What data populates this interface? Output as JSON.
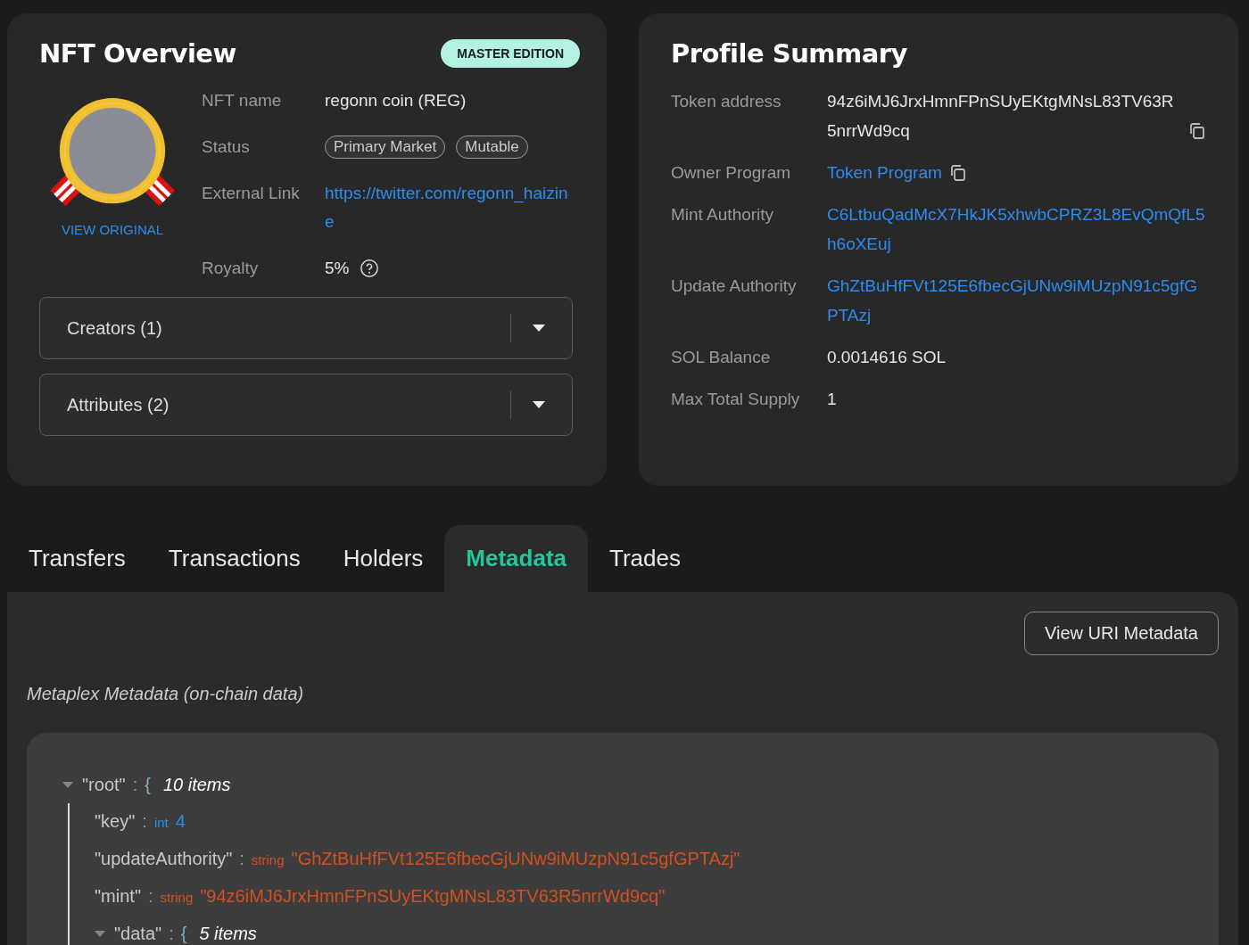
{
  "nft_overview": {
    "title": "NFT Overview",
    "edition_badge": "MASTER EDITION",
    "view_original": "VIEW ORIGINAL",
    "fields": [
      {
        "kind": "text",
        "label": "NFT name",
        "value": "regonn coin (REG)"
      },
      {
        "kind": "tags",
        "label": "Status",
        "tags": [
          "Primary Market",
          "Mutable"
        ]
      },
      {
        "kind": "link",
        "label": "External Link",
        "value": "https://twitter.com/regonn_haizine"
      },
      {
        "kind": "help",
        "label": "Royalty",
        "value": "5%"
      }
    ],
    "accordions": [
      {
        "label": "Creators (1)",
        "expanded": false
      },
      {
        "label": "Attributes (2)",
        "expanded": false
      }
    ]
  },
  "profile_summary": {
    "title": "Profile Summary",
    "fields": [
      {
        "kind": "text",
        "label": "Token address",
        "value": "94z6iMJ6JrxHmnFPnSUyEKtgMNsL83TV63R5nrrWd9cq",
        "copy": true
      },
      {
        "kind": "link",
        "label": "Owner Program",
        "value": "Token Program",
        "copy": true
      },
      {
        "kind": "link",
        "label": "Mint Authority",
        "value": "C6LtbuQadMcX7HkJK5xhwbCPRZ3L8EvQmQfL5h6oXEuj",
        "copy": false
      },
      {
        "kind": "link",
        "label": "Update Authority",
        "value": "GhZtBuHfFVt125E6fbecGjUNw9iMUzpN91c5gfGPTAzj",
        "copy": false
      },
      {
        "kind": "text",
        "label": "SOL Balance",
        "value": "0.0014616 SOL",
        "copy": false
      },
      {
        "kind": "text",
        "label": "Max Total Supply",
        "value": "1",
        "copy": false
      }
    ]
  },
  "tabs": [
    {
      "label": "Transfers",
      "selected": false
    },
    {
      "label": "Transactions",
      "selected": false
    },
    {
      "label": "Holders",
      "selected": false
    },
    {
      "label": "Metadata",
      "selected": true
    },
    {
      "label": "Trades",
      "selected": false
    }
  ],
  "metadata_panel": {
    "button": "View URI Metadata",
    "subtitle": "Metaplex Metadata (on-chain data)",
    "tree": {
      "key": "\"root\"",
      "colon": ":",
      "kind": "object",
      "brace": "{",
      "count": "10 items",
      "expanded": true,
      "children": [
        {
          "key": "\"key\"",
          "colon": ":",
          "kind": "int",
          "type": "int",
          "value": "4"
        },
        {
          "key": "\"updateAuthority\"",
          "colon": ":",
          "kind": "string",
          "type": "string",
          "value": "\"GhZtBuHfFVt125E6fbecGjUNw9iMUzpN91c5gfGPTAzj\""
        },
        {
          "key": "\"mint\"",
          "colon": ":",
          "kind": "string",
          "type": "string",
          "value": "\"94z6iMJ6JrxHmnFPnSUyEKtgMNsL83TV63R5nrrWd9cq\""
        },
        {
          "key": "\"data\"",
          "colon": ":",
          "kind": "object",
          "brace": "{",
          "count": "5 items",
          "expanded": true
        }
      ]
    }
  }
}
